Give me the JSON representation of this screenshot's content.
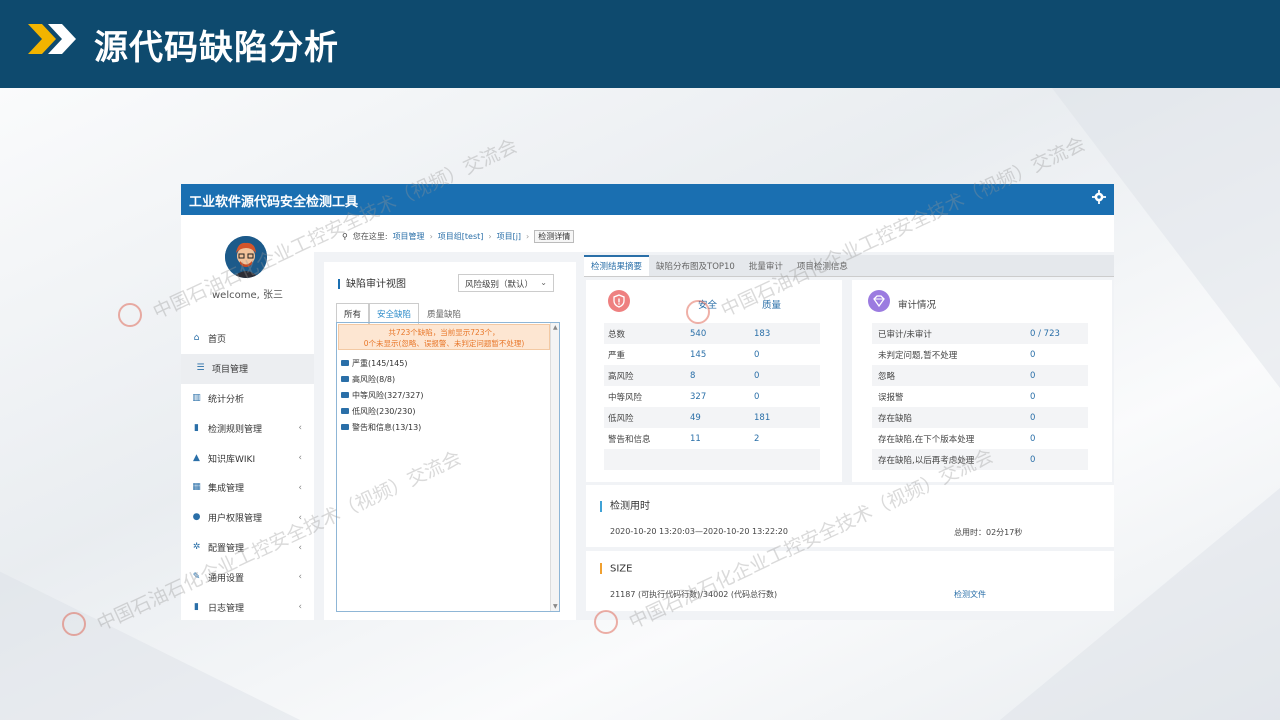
{
  "slide": {
    "title": "源代码缺陷分析"
  },
  "app": {
    "title": "工业软件源代码安全检测工具",
    "user": {
      "welcome": "welcome, 张三"
    },
    "nav": [
      {
        "label": "首页",
        "icon": "home-icon",
        "glyph": "⌂",
        "active": false,
        "has_arrow": false
      },
      {
        "label": "项目管理",
        "icon": "list-icon",
        "glyph": "☰",
        "active": true,
        "has_arrow": false
      },
      {
        "label": "统计分析",
        "icon": "bar-chart-icon",
        "glyph": "▥",
        "active": false,
        "has_arrow": false
      },
      {
        "label": "检测规则管理",
        "icon": "book-icon",
        "glyph": "▮",
        "active": false,
        "has_arrow": true
      },
      {
        "label": "知识库WIKI",
        "icon": "graduation-cap-icon",
        "glyph": "▲",
        "active": false,
        "has_arrow": true
      },
      {
        "label": "集成管理",
        "icon": "grid-icon",
        "glyph": "▦",
        "active": false,
        "has_arrow": true
      },
      {
        "label": "用户权限管理",
        "icon": "users-icon",
        "glyph": "●",
        "active": false,
        "has_arrow": true
      },
      {
        "label": "配置管理",
        "icon": "cog-icon",
        "glyph": "✲",
        "active": false,
        "has_arrow": true
      },
      {
        "label": "通用设置",
        "icon": "wrench-icon",
        "glyph": "✎",
        "active": false,
        "has_arrow": true
      },
      {
        "label": "日志管理",
        "icon": "book-icon",
        "glyph": "▮",
        "active": false,
        "has_arrow": true
      }
    ],
    "nav_arrow": "‹",
    "breadcrumb": {
      "prefix": "您在这里:",
      "items": [
        "项目管理",
        "项目组[test]",
        "项目[j]"
      ],
      "current": "检测详情",
      "sep": "›"
    },
    "audit_view": {
      "title": "缺陷审计视图",
      "risk_select": "风险级别（默认）",
      "tabs": [
        "所有",
        "安全缺陷",
        "质量缺陷"
      ],
      "notice_line1": "共723个缺陷，当前显示723个，",
      "notice_line2": "0个未显示(忽略、误报警、未判定问题暂不处理)",
      "tree": [
        "严重(145/145)",
        "高风险(8/8)",
        "中等风险(327/327)",
        "低风险(230/230)",
        "警告和信息(13/13)"
      ]
    },
    "result_tabs": [
      "检测结果摘要",
      "缺陷分布图及TOP10",
      "批量审计",
      "项目检测信息"
    ],
    "summary": {
      "col_security": "安全",
      "col_quality": "质量",
      "rows": [
        {
          "label": "总数",
          "security": "540",
          "quality": "183"
        },
        {
          "label": "严重",
          "security": "145",
          "quality": "0"
        },
        {
          "label": "高风险",
          "security": "8",
          "quality": "0"
        },
        {
          "label": "中等风险",
          "security": "327",
          "quality": "0"
        },
        {
          "label": "低风险",
          "security": "49",
          "quality": "181"
        },
        {
          "label": "警告和信息",
          "security": "11",
          "quality": "2"
        }
      ]
    },
    "audit_status": {
      "title": "审计情况",
      "rows": [
        {
          "label": "已审计/未审计",
          "value": "0 / 723"
        },
        {
          "label": "未判定问题,暂不处理",
          "value": "0"
        },
        {
          "label": "忽略",
          "value": "0"
        },
        {
          "label": "误报警",
          "value": "0"
        },
        {
          "label": "存在缺陷",
          "value": "0"
        },
        {
          "label": "存在缺陷,在下个版本处理",
          "value": "0"
        },
        {
          "label": "存在缺陷,以后再考虑处理",
          "value": "0"
        }
      ]
    },
    "detect_time": {
      "title": "检测用时",
      "range": "2020-10-20 13:20:03—2020-10-20 13:22:20",
      "duration": "总用时：02分17秒"
    },
    "size": {
      "title": "SIZE",
      "text": "21187 (可执行代码行数)/34002 (代码总行数)",
      "link": "检测文件"
    }
  },
  "watermark": "中国石油石化企业工控安全技术（视频）交流会",
  "colors": {
    "header": "#0e4a6e",
    "chevron": "#f2b400",
    "app_topbar": "#1a6fb1",
    "link": "#2a6fa8",
    "notice_text": "#e8772a",
    "security_icon": "#ee8080",
    "audit_icon": "#9b7be0",
    "time_bar": "#3fa2d6",
    "size_bar": "#f0a030"
  }
}
